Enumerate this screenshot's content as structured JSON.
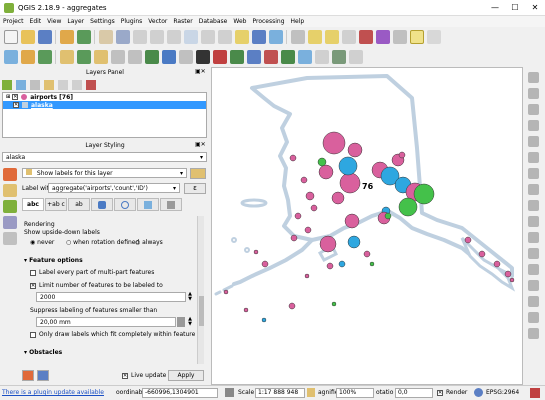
{
  "window": {
    "title": "QGIS 2.18.9 - aggregates",
    "min": "—",
    "max": "☐",
    "close": "✕"
  },
  "menu": [
    "Project",
    "Edit",
    "View",
    "Layer",
    "Settings",
    "Plugins",
    "Vector",
    "Raster",
    "Database",
    "Web",
    "Processing",
    "Help"
  ],
  "layers_panel": {
    "title": "Layers Panel",
    "layers": [
      {
        "name": "airports [76]",
        "checked": "✕"
      },
      {
        "name": "alaska",
        "checked": "✕"
      }
    ]
  },
  "layer_styling": {
    "title": "Layer Styling",
    "layer_select": "alaska",
    "mode_select": "Show labels for this layer",
    "label_with": "Label with",
    "label_expr": "aggregate('airports','count','ID')",
    "tabs": [
      "abc",
      "+ab c",
      "ab",
      "",
      "",
      "",
      ""
    ],
    "rendering_header": "Rendering",
    "upside_down_label": "Show upside-down labels",
    "radio_never": "never",
    "radio_rotation": "when rotation defined",
    "radio_always": "always",
    "feature_options_header": "Feature options",
    "label_every_part": "Label every part of multi-part features",
    "limit_features": "Limit number of features to be labeled to",
    "limit_value": "2000",
    "suppress_label": "Suppress labeling of features smaller than",
    "suppress_value": "20,00 mm",
    "only_fit": "Only draw labels which fit completely within feature",
    "obstacles_header": "Obstacles",
    "live_update": "Live update",
    "apply": "Apply"
  },
  "map": {
    "label_76": "76",
    "colors": {
      "pink": "#d9609d",
      "blue": "#2ea7e0",
      "green": "#44c14a",
      "land": "#bfd0e0"
    }
  },
  "status": {
    "plugin_update": "There is a plugin update available",
    "coord_label": "oordinab",
    "coord_value": "-660996,1304901",
    "scale_label": "Scale",
    "scale_value": "1:17 888 948",
    "magnifier_label": "agnifie",
    "magnifier_value": "100%",
    "rotation_label": "otatio",
    "rotation_value": "0,0",
    "render_label": "Render",
    "crs": "EPSG:2964"
  }
}
